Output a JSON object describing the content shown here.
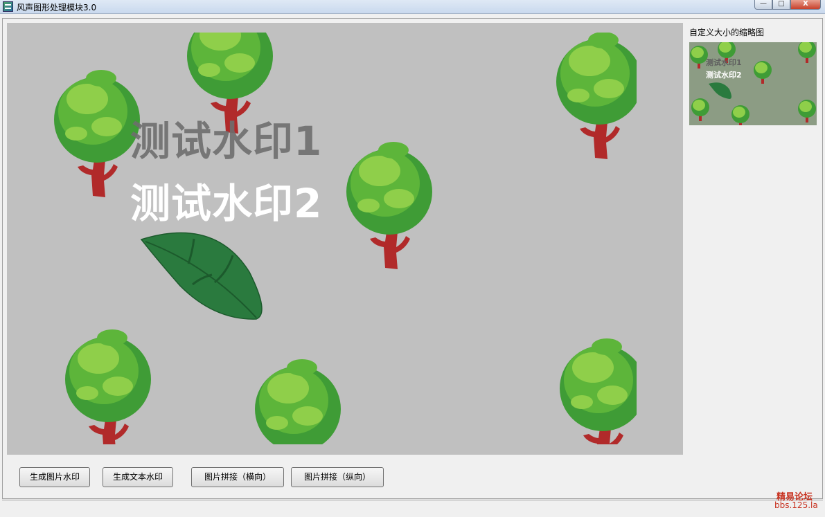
{
  "window": {
    "title": "风声图形处理模块3.0",
    "minimize_glyph": "—",
    "maximize_glyph": "□",
    "close_glyph": "X"
  },
  "preview": {
    "watermark_text_1": "测试水印1",
    "watermark_text_2": "测试水印2",
    "background_color": "#c0c0c0"
  },
  "thumbnail": {
    "label": "自定义大小的缩略图",
    "watermark_text_1": "测试水印1",
    "watermark_text_2": "测试水印2"
  },
  "buttons": {
    "image_watermark": "生成图片水印",
    "text_watermark": "生成文本水印",
    "stitch_horizontal": "图片拼接（横向）",
    "stitch_vertical": "图片拼接（纵向）"
  },
  "branding": {
    "name": "精易论坛",
    "url": "bbs.125.la"
  },
  "colors": {
    "tree_dark": "#3f9c36",
    "tree_mid": "#5db53a",
    "tree_light": "#8fcf4a",
    "trunk": "#b12a2a",
    "leaf": "#2a7a3e",
    "brand_red": "#c8311f"
  },
  "icons": {
    "app": "app-icon",
    "minimize": "minimize-icon",
    "maximize": "maximize-icon",
    "close": "close-icon"
  }
}
